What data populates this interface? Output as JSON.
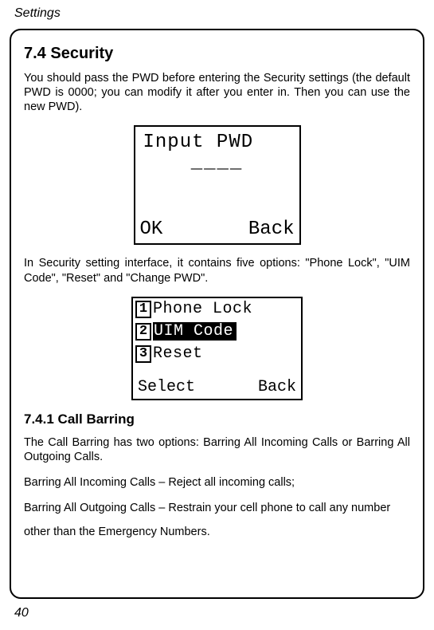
{
  "header": {
    "sectionLabel": "Settings"
  },
  "section": {
    "number": "7.4",
    "title": "Security",
    "intro": "You should pass the PWD before entering the Security settings (the default PWD is 0000; you can modify it after you enter in. Then you can use the new PWD).",
    "pwdScreen": {
      "title": "Input PWD",
      "dashes": "____",
      "leftSoftkey": "OK",
      "rightSoftkey": "Back"
    },
    "menuIntro": "In Security setting interface, it contains five options: \"Phone Lock\", \"UIM Code\", \"Reset\" and \"Change PWD\".",
    "menuScreen": {
      "items": [
        {
          "num": "1",
          "label": "Phone Lock",
          "selected": false
        },
        {
          "num": "2",
          "label": "UIM Code",
          "selected": true
        },
        {
          "num": "3",
          "label": "Reset",
          "selected": false
        }
      ],
      "leftSoftkey": "Select",
      "rightSoftkey": "Back"
    },
    "subsection": {
      "number": "7.4.1",
      "title": "Call Barring",
      "p1": "The Call Barring has two options: Barring All Incoming Calls or Barring All Outgoing Calls.",
      "p2": "Barring All Incoming Calls – Reject all incoming calls;",
      "p3": "Barring All Outgoing Calls – Restrain your cell phone to call any number",
      "p4": "other than the Emergency Numbers."
    }
  },
  "footer": {
    "pageNumber": "40"
  }
}
